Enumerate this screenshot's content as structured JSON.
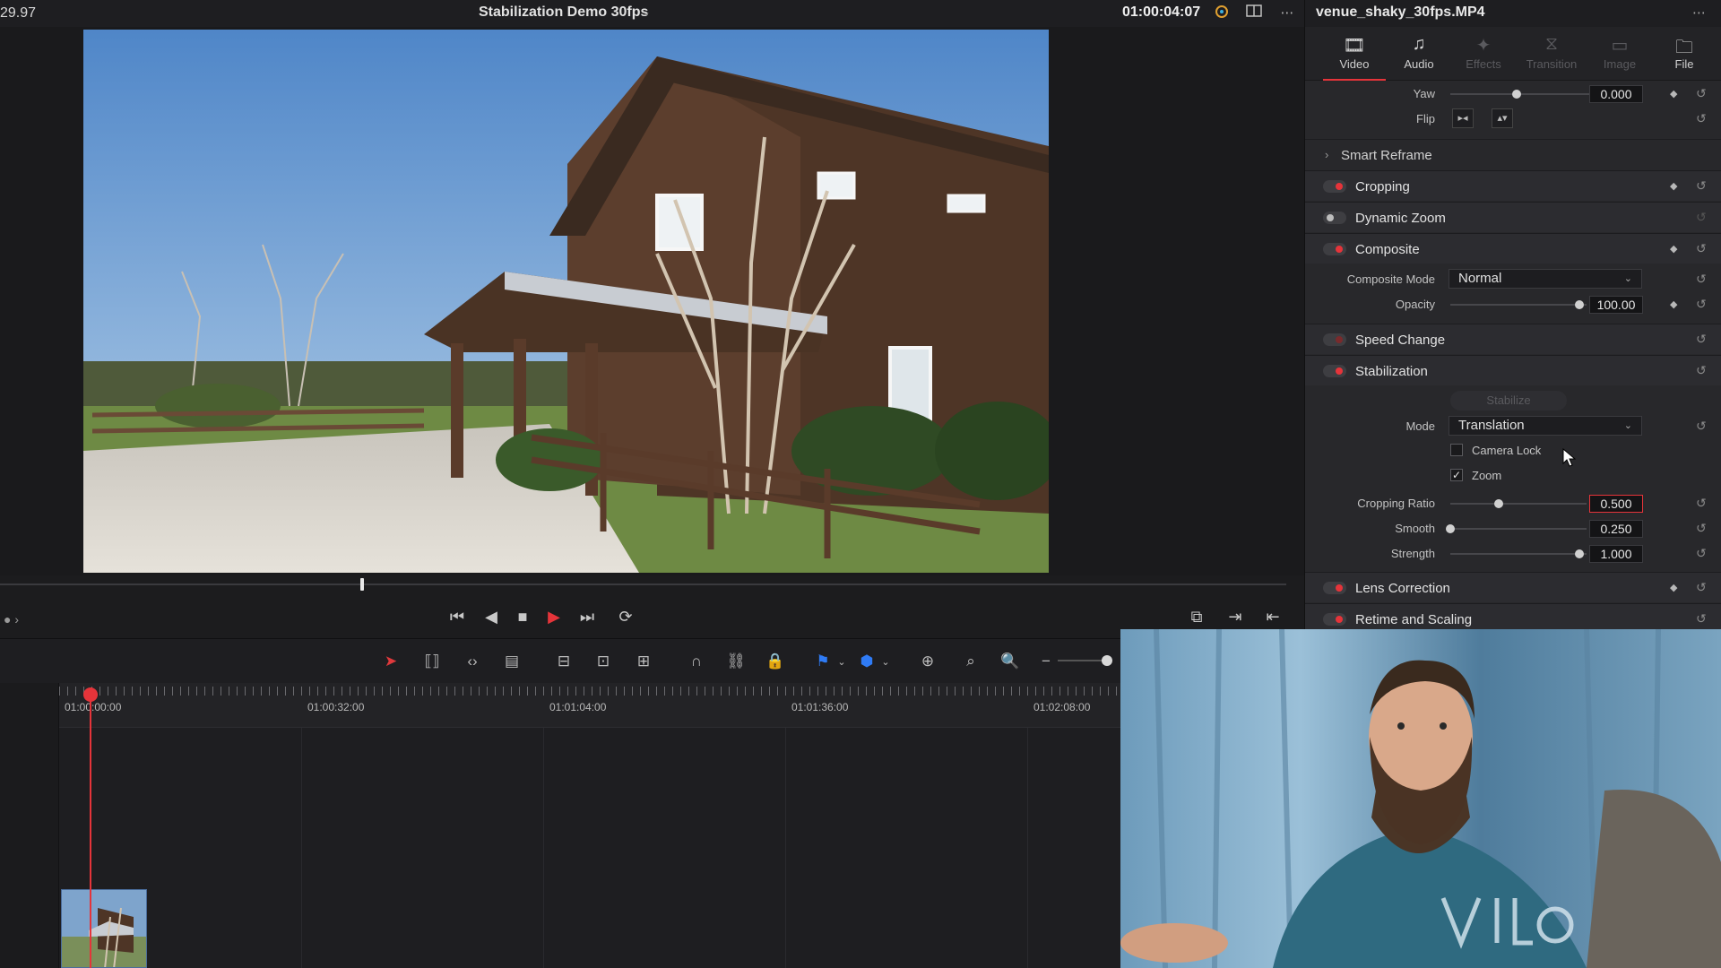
{
  "topbar": {
    "fps": "29.97",
    "project_title": "Stabilization Demo 30fps",
    "timecode": "01:00:04:07"
  },
  "timeline": {
    "ruler_labels": [
      "01:00:00:00",
      "01:00:32:00",
      "01:01:04:00",
      "01:01:36:00",
      "01:02:08:00"
    ]
  },
  "inspector": {
    "clip_name": "venue_shaky_30fps.MP4",
    "tabs": [
      {
        "label": "Video",
        "active": true
      },
      {
        "label": "Audio",
        "active": false
      },
      {
        "label": "Effects",
        "active": false
      },
      {
        "label": "Transition",
        "active": false
      },
      {
        "label": "Image",
        "active": false
      },
      {
        "label": "File",
        "active": false
      }
    ],
    "yaw": {
      "label": "Yaw",
      "value": "0.000"
    },
    "flip": {
      "label": "Flip"
    },
    "smart_reframe": "Smart Reframe",
    "sections": {
      "cropping": "Cropping",
      "dynamic_zoom": "Dynamic Zoom",
      "composite": "Composite",
      "speed_change": "Speed Change",
      "stabilization": "Stabilization",
      "lens_correction": "Lens Correction",
      "retime_scaling": "Retime and Scaling"
    },
    "composite_mode": {
      "label": "Composite Mode",
      "value": "Normal"
    },
    "opacity": {
      "label": "Opacity",
      "value": "100.00"
    },
    "stabilize_button": "Stabilize",
    "mode": {
      "label": "Mode",
      "value": "Translation"
    },
    "camera_lock": {
      "label": "Camera Lock",
      "checked": false
    },
    "zoom": {
      "label": "Zoom",
      "checked": true
    },
    "cropping_ratio": {
      "label": "Cropping Ratio",
      "value": "0.500"
    },
    "smooth": {
      "label": "Smooth",
      "value": "0.250"
    },
    "strength": {
      "label": "Strength",
      "value": "1.000"
    }
  },
  "colors": {
    "accent_red": "#e5343a",
    "panel_bg": "#28282b",
    "viewer_bg": "#1a1a1c"
  }
}
